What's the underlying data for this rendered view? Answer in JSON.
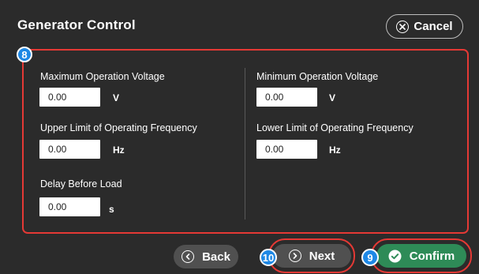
{
  "header": {
    "title": "Generator Control",
    "cancel_label": "Cancel"
  },
  "badges": {
    "form_panel": "8",
    "confirm": "9",
    "next": "10"
  },
  "fields": {
    "max_voltage": {
      "label": "Maximum Operation Voltage",
      "value": "0.00",
      "unit": "V"
    },
    "min_voltage": {
      "label": "Minimum Operation Voltage",
      "value": "0.00",
      "unit": "V"
    },
    "upper_freq": {
      "label": "Upper Limit of Operating Frequency",
      "value": "0.00",
      "unit": "Hz"
    },
    "lower_freq": {
      "label": "Lower Limit of Operating Frequency",
      "value": "0.00",
      "unit": "Hz"
    },
    "delay": {
      "label": "Delay Before Load",
      "value": "0.00",
      "unit": "s"
    }
  },
  "footer": {
    "back_label": "Back",
    "next_label": "Next",
    "confirm_label": "Confirm"
  },
  "colors": {
    "background": "#2b2b2b",
    "highlight": "#e53935",
    "badge": "#1e88e5",
    "confirm": "#2e8b57",
    "secondary_button": "#505050"
  }
}
